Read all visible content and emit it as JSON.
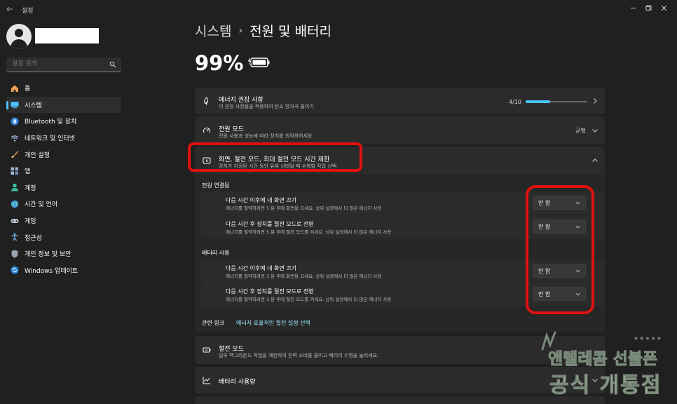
{
  "window": {
    "title": "설정"
  },
  "sidebar": {
    "search_placeholder": "설정 검색",
    "items": [
      {
        "label": "홈",
        "icon": "home-icon"
      },
      {
        "label": "시스템",
        "icon": "system-icon",
        "active": true
      },
      {
        "label": "Bluetooth 및 장치",
        "icon": "bluetooth-icon"
      },
      {
        "label": "네트워크 및 인터넷",
        "icon": "network-icon"
      },
      {
        "label": "개인 설정",
        "icon": "brush-icon"
      },
      {
        "label": "앱",
        "icon": "apps-icon"
      },
      {
        "label": "계정",
        "icon": "account-icon"
      },
      {
        "label": "시간 및 언어",
        "icon": "globe-icon"
      },
      {
        "label": "게임",
        "icon": "gamepad-icon"
      },
      {
        "label": "접근성",
        "icon": "accessibility-icon"
      },
      {
        "label": "개인 정보 및 보안",
        "icon": "shield-icon"
      },
      {
        "label": "Windows 업데이트",
        "icon": "update-icon"
      }
    ]
  },
  "breadcrumb": {
    "root": "시스템",
    "separator": "›",
    "current": "전원 및 배터리"
  },
  "battery": {
    "percent": "99%",
    "charge_fraction": 0.99
  },
  "cards": {
    "energy": {
      "title": "에너지 권장 사항",
      "desc": "이 권장 사항들을 적용하여 탄소 방자국 줄이기",
      "progress_label": "4/10",
      "progress_fraction": 0.4
    },
    "power_mode": {
      "title": "전원 모드",
      "desc": "전원 사용과 성능에 따라 장치를 최적화하세요",
      "value": "균형"
    },
    "screen_sleep": {
      "title": "화면, 절전 모드, 최대 절전 모드 시간 제한",
      "desc": "장치가 지정된 시간 동안 유휴 상태일 때 수행할 작업 선택"
    },
    "sleep_mode": {
      "title": "절전 모드",
      "desc": "일부 백그라운드 작업을 제한하여 전력 소비를 줄이고 배터리 수명을 늘리세요."
    },
    "battery_usage": {
      "title": "배터리 사용량"
    }
  },
  "plugged_in": {
    "label": "전원 연결됨",
    "rows": [
      {
        "title": "다음 시간 이후에 내 화면 끄기",
        "desc": "에너지를 절약하려면 5 분 후에 화면을 끄세요. 상위 설정에서 더 많은 에너지 사용",
        "value": "안 함"
      },
      {
        "title": "다음 시간 후 장치를 절전 모드로 전환",
        "desc": "에너지를 절약하려면 5 분 후에 절전 모드를 켜세요. 상위 설정에서 더 많은 에너지 사용",
        "value": "안 함"
      }
    ]
  },
  "on_battery": {
    "label": "배터리 사용",
    "rows": [
      {
        "title": "다음 시간 이후에 내 화면 끄기",
        "desc": "에너지를 절약하려면 3 분 후에 화면을 끄세요. 상위 설정에서 더 많은 에너지 사용",
        "value": "안 함"
      },
      {
        "title": "다음 시간 후 장치를 절전 모드로 전환",
        "desc": "에너지를 절약하려면 3 분 후에 절전 모드를 켜세요. 상위 설정에서 더 많은 에너지 사용",
        "value": "안 함"
      }
    ]
  },
  "related": {
    "label": "관련 링크",
    "link": "에너지 효율적인 절전 설정 선택"
  },
  "watermark": {
    "line1": "앤텔레콤 선불폰",
    "line2": "공식 개통점",
    "stars": "★★★★★"
  },
  "colors": {
    "accent": "#4cc2ff",
    "highlight": "#e01010",
    "background": "#202020",
    "card": "#2b2b2b"
  }
}
